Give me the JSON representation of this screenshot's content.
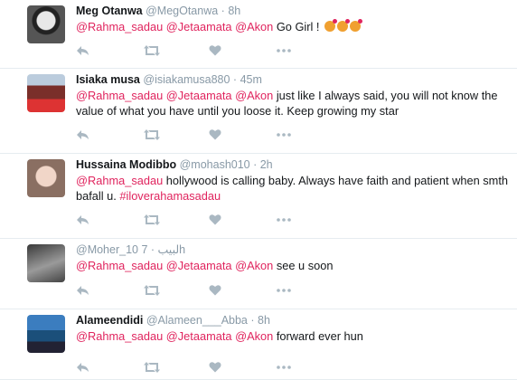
{
  "colors": {
    "mention": "#e0245e",
    "meta": "#8899a6",
    "icon": "#aab8c2"
  },
  "tweets": [
    {
      "fullname": "Meg Otanwa",
      "username": "@MegOtanwa",
      "time": "8h",
      "segments": [
        {
          "type": "mention",
          "text": "@Rahma_sadau"
        },
        {
          "type": "text",
          "text": " "
        },
        {
          "type": "mention",
          "text": "@Jetaamata"
        },
        {
          "type": "text",
          "text": " "
        },
        {
          "type": "mention",
          "text": "@Akon"
        },
        {
          "type": "text",
          "text": " Go Girl ! "
        }
      ],
      "emojis": [
        "kissing-face-emoji",
        "kissing-face-emoji",
        "kissing-face-emoji"
      ]
    },
    {
      "fullname": "Isiaka musa",
      "username": "@isiakamusa880",
      "time": "45m",
      "segments": [
        {
          "type": "mention",
          "text": "@Rahma_sadau"
        },
        {
          "type": "text",
          "text": " "
        },
        {
          "type": "mention",
          "text": "@Jetaamata"
        },
        {
          "type": "text",
          "text": " "
        },
        {
          "type": "mention",
          "text": "@Akon"
        },
        {
          "type": "text",
          "text": " just like I always said, you will not know the value of what you have until you loose it. Keep growing my star"
        }
      ],
      "emojis": []
    },
    {
      "fullname": "Hussaina Modibbo",
      "username": "@mohash010",
      "time": "2h",
      "segments": [
        {
          "type": "mention",
          "text": "@Rahma_sadau"
        },
        {
          "type": "text",
          "text": " hollywood is calling baby. Always have faith and patient when smth bafall u. "
        },
        {
          "type": "hashtag",
          "text": "#iloverahamasadau"
        }
      ],
      "emojis": []
    },
    {
      "fullname": "",
      "username": "@Moher_10",
      "username_suffix": " لبيب",
      "time": "7h",
      "segments": [
        {
          "type": "mention",
          "text": "@Rahma_sadau"
        },
        {
          "type": "text",
          "text": " "
        },
        {
          "type": "mention",
          "text": "@Jetaamata"
        },
        {
          "type": "text",
          "text": " "
        },
        {
          "type": "mention",
          "text": "@Akon"
        },
        {
          "type": "text",
          "text": " see u soon"
        }
      ],
      "emojis": []
    },
    {
      "fullname": "Alameendidi",
      "username": "@Alameen___Abba",
      "time": "8h",
      "segments": [
        {
          "type": "mention",
          "text": "@Rahma_sadau"
        },
        {
          "type": "text",
          "text": " "
        },
        {
          "type": "mention",
          "text": "@Jetaamata"
        },
        {
          "type": "text",
          "text": " "
        },
        {
          "type": "mention",
          "text": "@Akon"
        },
        {
          "type": "text",
          "text": " forward ever hun"
        }
      ],
      "emojis": []
    }
  ]
}
